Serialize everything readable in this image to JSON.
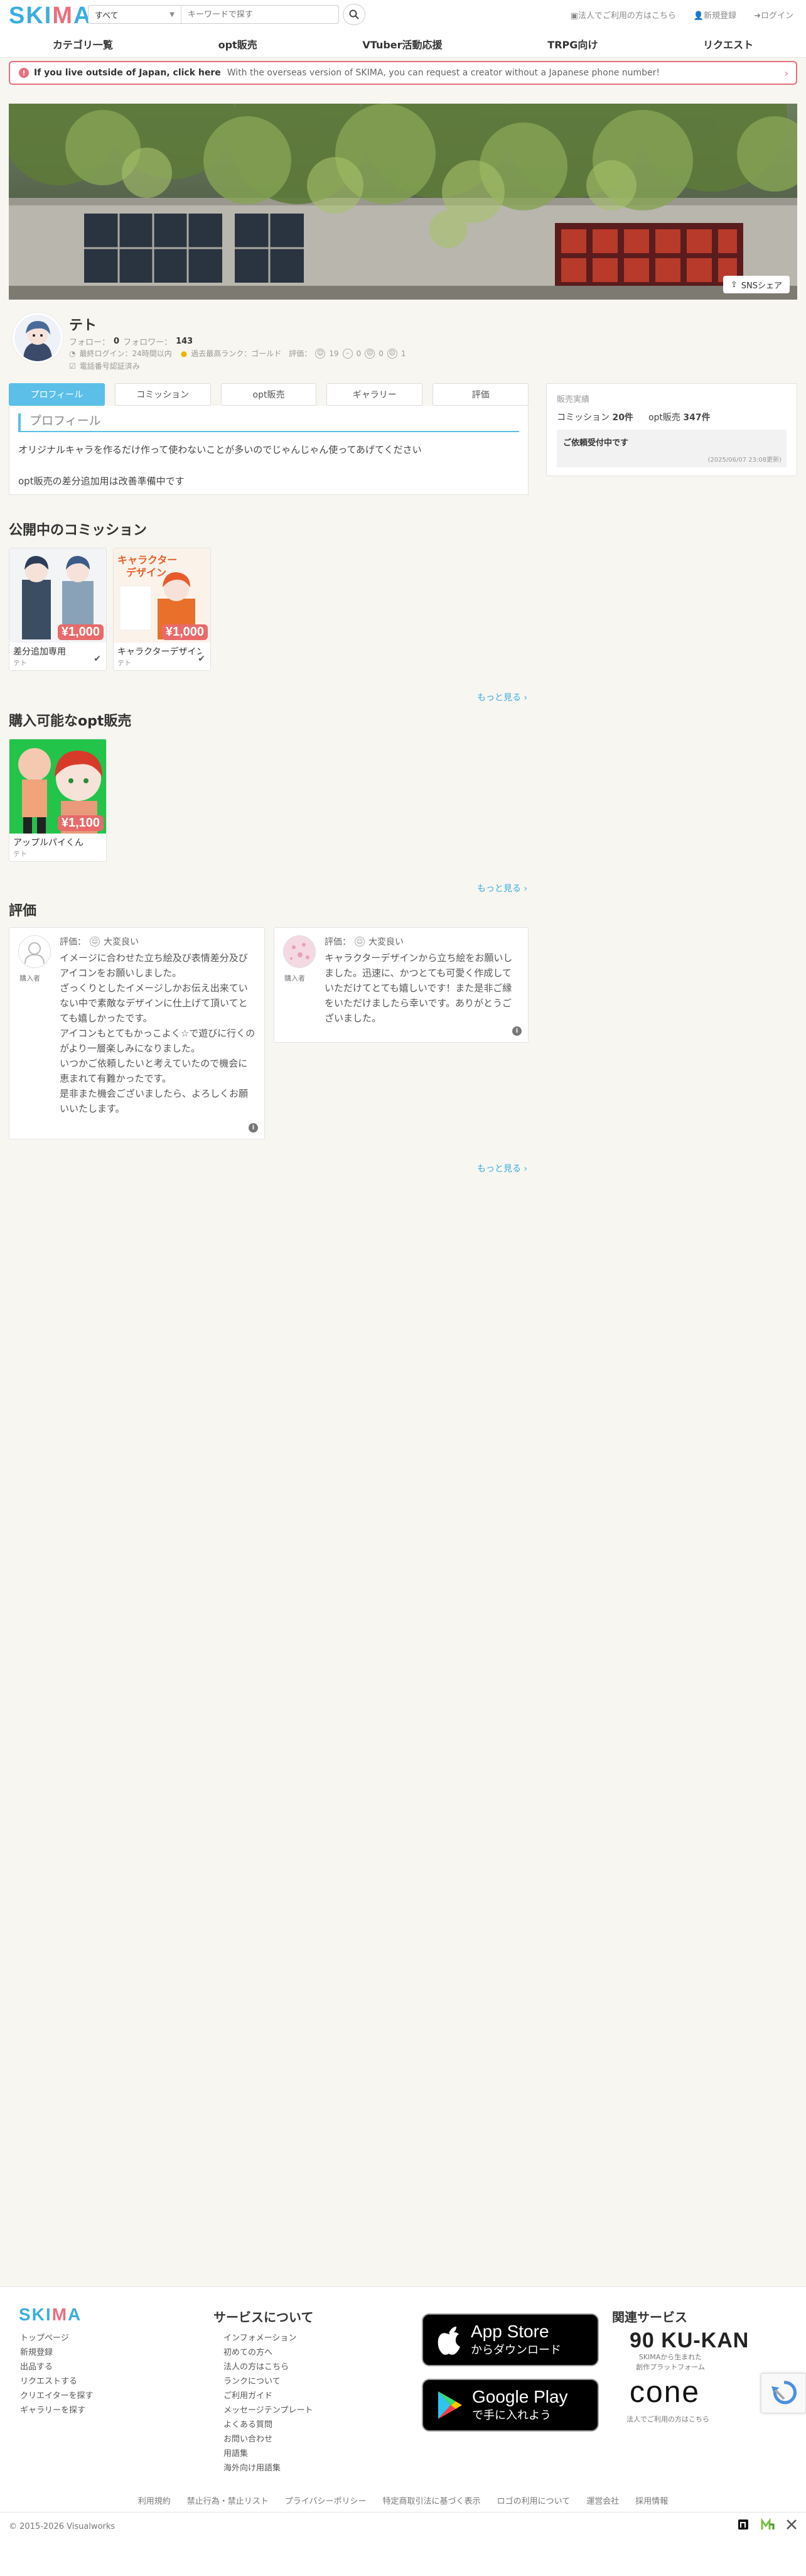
{
  "header": {
    "logo_main": "SKI",
    "logo_accent": "M",
    "logo_end": "A",
    "search_category": "すべて",
    "search_placeholder": "キーワードで探す",
    "links": [
      "法人でご利用の方はこちら",
      "新規登録",
      "ログイン"
    ]
  },
  "nav": [
    "カテゴリ一覧",
    "opt販売",
    "VTuber活動応援",
    "TRPG向け",
    "リクエスト"
  ],
  "overseas": {
    "link": "If you live outside of Japan, click here",
    "text": "With the overseas version of SKIMA, you can request a creator without a Japanese phone number!"
  },
  "share_label": "SNSシェア",
  "profile": {
    "name": "テト",
    "follow_label": "フォロー：",
    "follow_count": "0",
    "follower_label": "フォロワー：",
    "follower_count": "143",
    "last_login": "最終ログイン：24時間以内",
    "rank": "過去最高ランク：ゴールド",
    "eval_label": "評価：",
    "eval_good": "19",
    "eval_normal": "0",
    "eval_bad_a": "0",
    "eval_bad_b": "1",
    "verified": "電話番号認証済み"
  },
  "tabs": [
    "プロフィール",
    "コミッション",
    "opt販売",
    "ギャラリー",
    "評価"
  ],
  "profile_card": {
    "heading": "プロフィール",
    "line1": "オリジナルキャラを作るだけ作って使わないことが多いのでじゃんじゃん使ってあげてください",
    "line2": "opt販売の差分追加用は改善準備中です"
  },
  "sales": {
    "title": "販売実績",
    "commission_label": "コミッション",
    "commission_count": "20件",
    "opt_label": "opt販売",
    "opt_count": "347件",
    "status": "ご依頼受付中です",
    "date": "(2025/06/07 23:08更新)"
  },
  "commissions": {
    "title": "公開中のコミッション",
    "more": "もっと見る ›",
    "items": [
      {
        "price": "¥1,000",
        "title": "差分追加専用",
        "seller": "テト"
      },
      {
        "price": "¥1,000",
        "title": "キャラクターデザイン",
        "seller": "テト"
      }
    ]
  },
  "opt": {
    "title": "購入可能なopt販売",
    "more": "もっと見る ›",
    "items": [
      {
        "price": "¥1,100",
        "title": "アップルパイくん",
        "seller": "テト"
      }
    ]
  },
  "reviews": {
    "title": "評価",
    "more": "もっと見る ›",
    "items": [
      {
        "rating_label": "評価：",
        "rating": "大変良い",
        "badge": "購入者",
        "lines": [
          "イメージに合わせた立ち絵及び表情差分及びアイコンをお願いしました。",
          "ざっくりとしたイメージしかお伝え出来ていない中で素敵なデザインに仕上げて頂いてとても嬉しかったです。",
          "アイコンもとてもかっこよく☆で遊びに行くのがより一層楽しみになりました。",
          "いつかご依頼したいと考えていたので機会に恵まれて有難かったです。",
          "是非また機会ございましたら、よろしくお願いいたします。"
        ]
      },
      {
        "rating_label": "評価：",
        "rating": "大変良い",
        "badge": "購入者",
        "lines": [
          "キャラクターデザインから立ち絵をお願いしました。迅速に、かつとても可愛く作成していただけてとても嬉しいです！また是非ご縁をいただけましたら幸いです。ありがとうございました。"
        ]
      }
    ]
  },
  "footer": {
    "logo_main": "SKI",
    "logo_accent": "M",
    "logo_end": "A",
    "col1": [
      "トップページ",
      "新規登録",
      "出品する",
      "リクエストする",
      "クリエイターを探す",
      "ギャラリーを探す"
    ],
    "col2_title": "サービスについて",
    "col2": [
      "インフォメーション",
      "初めての方へ",
      "法人の方はこちら",
      "ランクについて",
      "ご利用ガイド",
      "メッセージテンプレート",
      "よくある質問",
      "お問い合わせ",
      "用語集",
      "海外向け用語集"
    ],
    "appstore_small": "",
    "appstore_big": "App Store",
    "appstore_sub": "からダウンロード",
    "gplay_big": "Google Play",
    "gplay_sub": "で手に入れよう",
    "related_title": "関連サービス",
    "ku_logo": "90 KU-KAN",
    "ku_sub1": "SKIMAから生まれた",
    "ku_sub2": "創作プラットフォーム",
    "cone_logo": "cone",
    "cone_sub": "法人でご利用の方はこちら",
    "links": [
      "利用規約",
      "禁止行為・禁止リスト",
      "プライバシーポリシー",
      "特定商取引法に基づく表示",
      "ロゴの利用について",
      "運営会社",
      "採用情報"
    ],
    "copyright": "© 2015-2026 Visualworks"
  }
}
